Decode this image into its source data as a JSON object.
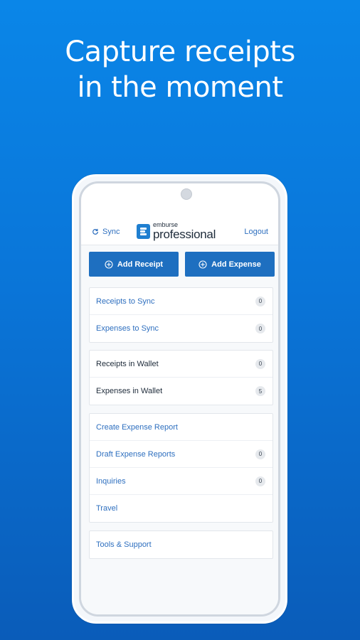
{
  "headline": {
    "line1": "Capture receipts",
    "line2": "in the moment"
  },
  "appbar": {
    "sync_label": "Sync",
    "logo_top": "emburse",
    "logo_main": "professional",
    "logout_label": "Logout"
  },
  "actions": {
    "add_receipt": "Add Receipt",
    "add_expense": "Add Expense"
  },
  "sync_group": [
    {
      "label": "Receipts to Sync",
      "count": "0"
    },
    {
      "label": "Expenses to Sync",
      "count": "0"
    }
  ],
  "wallet_group": [
    {
      "label": "Receipts in Wallet",
      "count": "0"
    },
    {
      "label": "Expenses in Wallet",
      "count": "5"
    }
  ],
  "reports_group": [
    {
      "label": "Create Expense Report"
    },
    {
      "label": "Draft Expense Reports",
      "count": "0"
    },
    {
      "label": "Inquiries",
      "count": "0"
    },
    {
      "label": "Travel"
    }
  ],
  "support_group": [
    {
      "label": "Tools & Support"
    }
  ],
  "colors": {
    "primary": "#1e6fc0",
    "link": "#2e6fbf",
    "background": "#0a75d8"
  }
}
